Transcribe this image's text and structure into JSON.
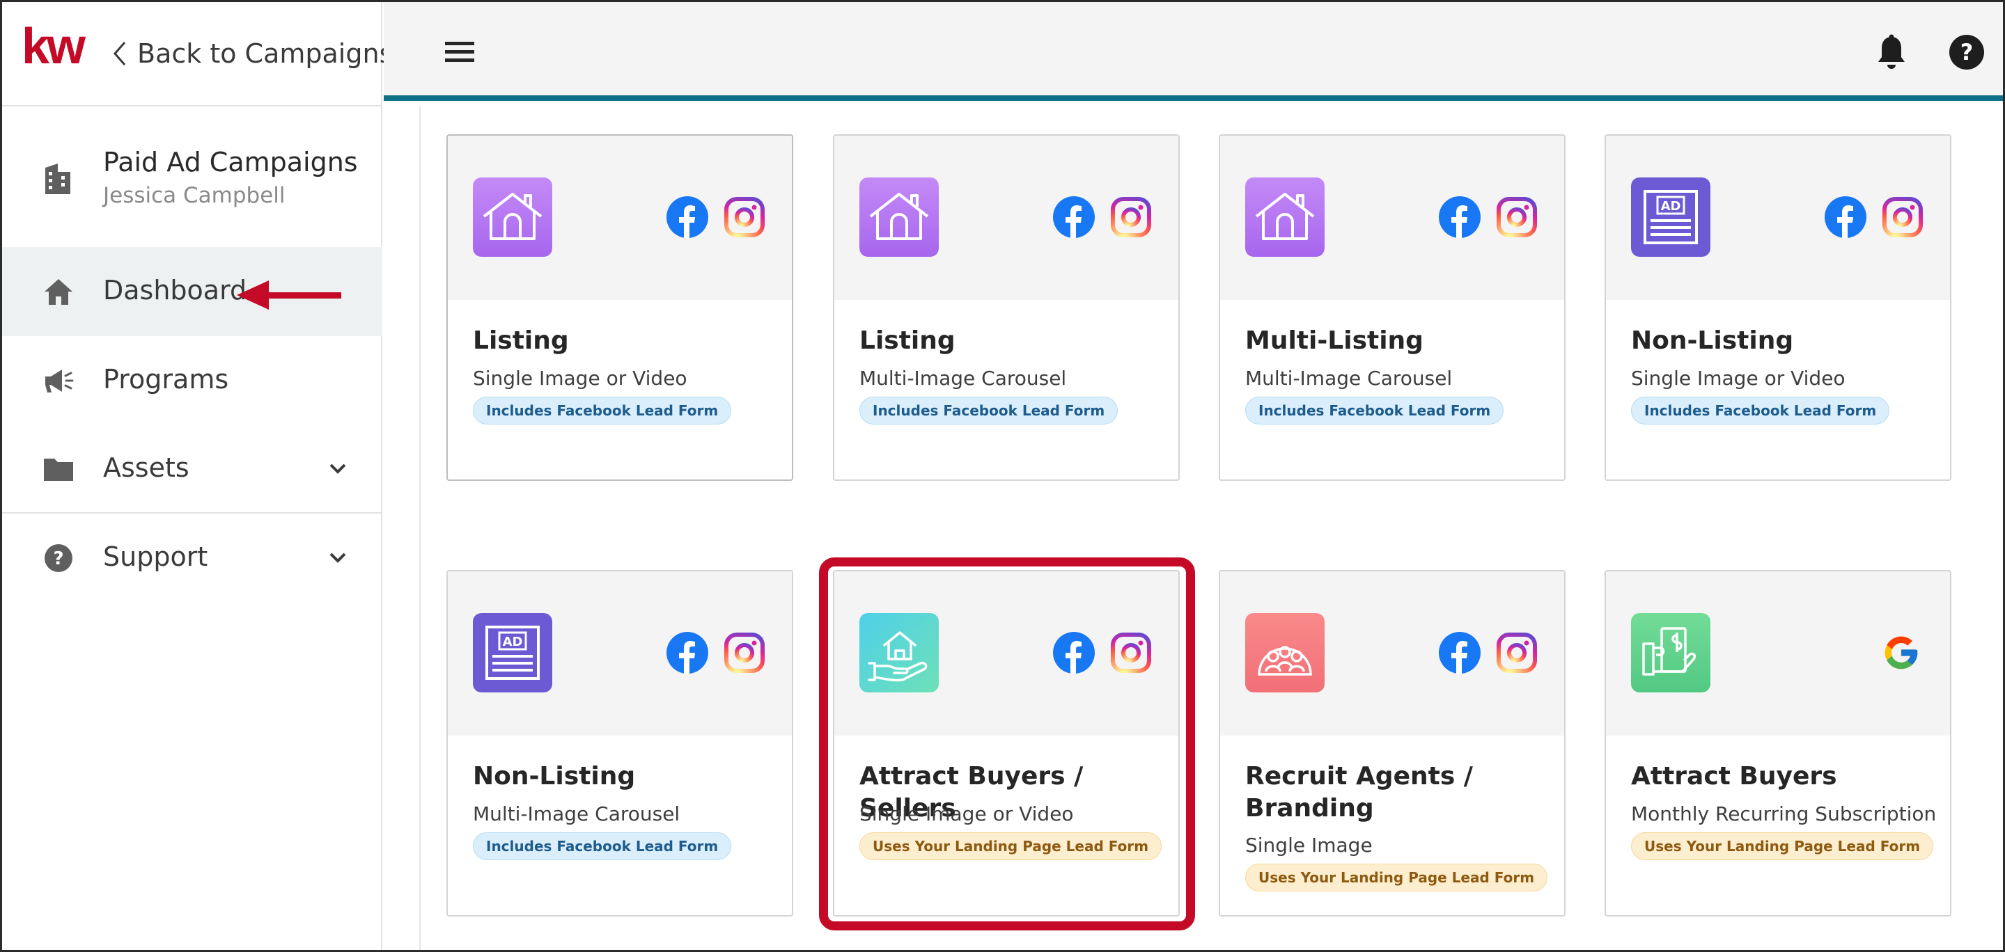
{
  "app": {
    "logo": "kw",
    "back_label": "Back to Campaigns"
  },
  "account": {
    "title": "Paid Ad Campaigns",
    "subtitle": "Jessica Campbell"
  },
  "nav": {
    "dashboard": "Dashboard",
    "programs": "Programs",
    "assets": "Assets",
    "support": "Support"
  },
  "cards": [
    {
      "title": "Listing",
      "subtitle": "Single Image or Video",
      "badge": "Includes Facebook Lead Form",
      "badge_type": "facebook-lead-form",
      "icon": "house-icon",
      "platforms": [
        "facebook",
        "instagram"
      ]
    },
    {
      "title": "Listing",
      "subtitle": "Multi-Image Carousel",
      "badge": "Includes Facebook Lead Form",
      "badge_type": "facebook-lead-form",
      "icon": "house-icon",
      "platforms": [
        "facebook",
        "instagram"
      ]
    },
    {
      "title": "Multi-Listing",
      "subtitle": "Multi-Image Carousel",
      "badge": "Includes Facebook Lead Form",
      "badge_type": "facebook-lead-form",
      "icon": "house-icon",
      "platforms": [
        "facebook",
        "instagram"
      ]
    },
    {
      "title": "Non-Listing",
      "subtitle": "Single Image or Video",
      "badge": "Includes Facebook Lead Form",
      "badge_type": "facebook-lead-form",
      "icon": "ad-icon",
      "icon_text": "AD",
      "platforms": [
        "facebook",
        "instagram"
      ]
    },
    {
      "title": "Non-Listing",
      "subtitle": "Multi-Image Carousel",
      "badge": "Includes Facebook Lead Form",
      "badge_type": "facebook-lead-form",
      "icon": "ad-icon",
      "icon_text": "AD",
      "platforms": [
        "facebook",
        "instagram"
      ]
    },
    {
      "title": "Attract Buyers / Sellers",
      "subtitle": "Single Image or Video",
      "badge": "Uses Your Landing Page Lead Form",
      "badge_type": "landing-page-lead-form",
      "icon": "house-in-hand-icon",
      "platforms": [
        "facebook",
        "instagram"
      ],
      "highlighted": true
    },
    {
      "title": "Recruit Agents / Branding",
      "subtitle": "Single Image",
      "badge": "Uses Your Landing Page Lead Form",
      "badge_type": "landing-page-lead-form",
      "icon": "group-icon",
      "platforms": [
        "facebook",
        "instagram"
      ]
    },
    {
      "title": "Attract Buyers",
      "subtitle": "Monthly Recurring Subscription",
      "badge": "Uses Your Landing Page Lead Form",
      "badge_type": "landing-page-lead-form",
      "icon": "money-hand-icon",
      "platforms": [
        "google"
      ]
    }
  ],
  "colors": {
    "brand_red": "#c40a26",
    "topbar_accent": "#0e6f86",
    "house_icon_bg": "#b276f2",
    "ad_icon_bg": "#6c5ad4",
    "house_hand_icon_bg": "#5bd8cf",
    "group_icon_bg": "#f57d7d",
    "money_icon_bg": "#5fd28e",
    "facebook_blue": "#1877f2"
  }
}
